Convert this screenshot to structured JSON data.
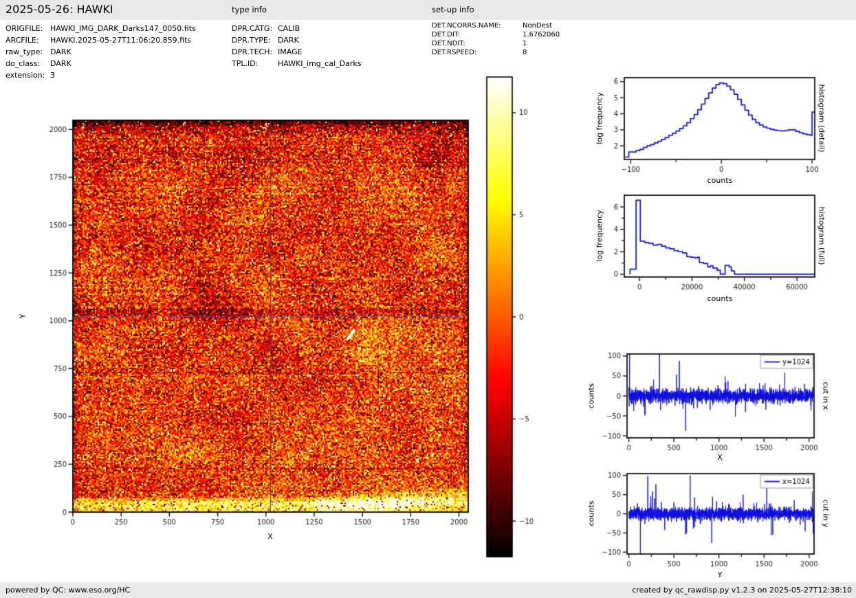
{
  "header": {
    "title": "2025-05-26: HAWKI",
    "type_info_label": "type info",
    "setup_info_label": "set-up info"
  },
  "file_info": {
    "rows": [
      {
        "label": "ORIGFILE:",
        "value": "HAWKI_IMG_DARK_Darks147_0050.fits"
      },
      {
        "label": "ARCFILE:",
        "value": "HAWKI.2025-05-27T11:06:20.859.fits"
      },
      {
        "label": "raw_type:",
        "value": "DARK"
      },
      {
        "label": "do_class:",
        "value": "DARK"
      },
      {
        "label": "extension:",
        "value": "3"
      }
    ]
  },
  "type_info": {
    "rows": [
      {
        "label": "DPR.CATG:",
        "value": "CALIB"
      },
      {
        "label": "DPR.TYPE:",
        "value": "DARK"
      },
      {
        "label": "DPR.TECH:",
        "value": "IMAGE"
      },
      {
        "label": "TPL.ID:",
        "value": "HAWKI_img_cal_Darks"
      }
    ]
  },
  "setup_info": {
    "rows": [
      {
        "label": "DET.NCORRS.NAME:",
        "value": "NonDest"
      },
      {
        "label": "DET.DIT:",
        "value": "1.6762060"
      },
      {
        "label": "DET.NDIT:",
        "value": "1"
      },
      {
        "label": "DET.RSPEED:",
        "value": "8"
      }
    ]
  },
  "footer": {
    "left": "powered by QC: www.eso.org/HC",
    "right": "created by qc_rawdisp.py v1.2.3 on 2025-05-27T12:38:10"
  },
  "colors": {
    "line_blue": "#0d0ddd",
    "crosshair_blue": "#2233cc",
    "bar_bg": "#e9e9e9",
    "spine": "#000000",
    "tick_text": "#1a1a1a"
  },
  "chart_data": [
    {
      "id": "main-image",
      "type": "heatmap",
      "xlabel": "X",
      "ylabel": "Y",
      "xlim": [
        0,
        2048
      ],
      "ylim": [
        0,
        2048
      ],
      "xticks": [
        0,
        250,
        500,
        750,
        1000,
        1250,
        1500,
        1750,
        2000
      ],
      "yticks": [
        0,
        250,
        500,
        750,
        1000,
        1250,
        1500,
        1750,
        2000
      ],
      "colormap": "hot",
      "value_range": [
        -11.75,
        11.75
      ],
      "crosshair": {
        "x": 1024,
        "y": 1024
      },
      "description": "2048x2048 noisy dark frame; dark band along top edge, bright white band along bottom edge, bright diagonal glow toward lower-right corner, dark stripe just above y=1024, white cosmic-ray streak near (1440,930), blue crosshair lines at x=1024 and y=1024",
      "render_params": {
        "seed": 99,
        "base_level": 0.46,
        "noise_sd": 0.16,
        "streak": {
          "x1": 1424,
          "y1": 905,
          "x2": 1456,
          "y2": 950
        }
      }
    },
    {
      "id": "colorbar",
      "type": "colorbar",
      "colormap": "hot",
      "vmin": -11.75,
      "vmax": 11.75,
      "ticks": [
        10,
        5,
        0,
        -5,
        -10
      ]
    },
    {
      "id": "hist-detail",
      "type": "line",
      "mode": "step",
      "xlabel": "counts",
      "ylabel": "log frequency",
      "side_label": "histogram (detail)",
      "xlim": [
        -107,
        103
      ],
      "ylim": [
        1.15,
        6.25
      ],
      "xticks": [
        -100,
        0,
        100
      ],
      "xminor": [
        -50,
        50
      ],
      "yticks": [
        2,
        3,
        4,
        5,
        6
      ],
      "yminor": [],
      "x": [
        -106,
        -102,
        -98,
        -94,
        -90,
        -86,
        -82,
        -78,
        -74,
        -70,
        -66,
        -62,
        -58,
        -54,
        -50,
        -46,
        -42,
        -38,
        -34,
        -30,
        -26,
        -22,
        -18,
        -14,
        -10,
        -6,
        -2,
        2,
        6,
        10,
        14,
        18,
        22,
        26,
        30,
        34,
        38,
        42,
        46,
        50,
        54,
        58,
        62,
        66,
        70,
        74,
        78,
        82,
        86,
        90,
        94,
        98,
        100,
        103
      ],
      "y": [
        1.3,
        1.62,
        1.62,
        1.7,
        1.78,
        1.9,
        2.0,
        2.08,
        2.18,
        2.28,
        2.4,
        2.52,
        2.65,
        2.78,
        2.92,
        3.08,
        3.25,
        3.45,
        3.7,
        3.95,
        4.25,
        4.6,
        4.95,
        5.3,
        5.6,
        5.82,
        5.92,
        5.88,
        5.72,
        5.5,
        5.22,
        4.9,
        4.55,
        4.22,
        3.92,
        3.65,
        3.45,
        3.3,
        3.18,
        3.1,
        3.03,
        2.98,
        2.95,
        2.93,
        2.95,
        3.0,
        3.0,
        2.9,
        2.82,
        2.75,
        2.7,
        2.65,
        4.1,
        4.1
      ]
    },
    {
      "id": "hist-full",
      "type": "line",
      "mode": "poly",
      "xlabel": "counts",
      "ylabel": "log frequency",
      "side_label": "histogram (full)",
      "xlim": [
        -5800,
        66800
      ],
      "ylim": [
        -0.25,
        7.05
      ],
      "xticks": [
        0,
        20000,
        40000,
        60000
      ],
      "xminor": [
        10000,
        30000,
        50000
      ],
      "yticks": [
        0,
        2,
        4,
        6
      ],
      "yminor": [
        1,
        3,
        5
      ],
      "points": [
        [
          -3600,
          0
        ],
        [
          -3600,
          0.45
        ],
        [
          -1300,
          0.45
        ],
        [
          -1300,
          6.6
        ],
        [
          300,
          6.6
        ],
        [
          300,
          2.95
        ],
        [
          2000,
          2.95
        ],
        [
          2000,
          2.82
        ],
        [
          3600,
          2.82
        ],
        [
          3600,
          2.76
        ],
        [
          5200,
          2.76
        ],
        [
          5200,
          2.6
        ],
        [
          6800,
          2.6
        ],
        [
          6800,
          2.66
        ],
        [
          8400,
          2.66
        ],
        [
          8400,
          2.5
        ],
        [
          10000,
          2.5
        ],
        [
          10000,
          2.35
        ],
        [
          11600,
          2.35
        ],
        [
          11600,
          2.27
        ],
        [
          13200,
          2.27
        ],
        [
          13200,
          2.1
        ],
        [
          14800,
          2.1
        ],
        [
          14800,
          2.02
        ],
        [
          16400,
          2.02
        ],
        [
          16400,
          1.9
        ],
        [
          18000,
          1.9
        ],
        [
          18000,
          1.57
        ],
        [
          19600,
          1.57
        ],
        [
          19600,
          1.5
        ],
        [
          21200,
          1.5
        ],
        [
          21200,
          1.45
        ],
        [
          22000,
          1.45
        ],
        [
          22000,
          1.52
        ],
        [
          22800,
          1.52
        ],
        [
          22800,
          1.05
        ],
        [
          24400,
          1.05
        ],
        [
          24400,
          0.95
        ],
        [
          26000,
          0.95
        ],
        [
          26000,
          0.65
        ],
        [
          27000,
          0.65
        ],
        [
          27000,
          0.75
        ],
        [
          28000,
          0.75
        ],
        [
          28000,
          0.55
        ],
        [
          29600,
          0.55
        ],
        [
          29600,
          0.35
        ],
        [
          30800,
          0.35
        ],
        [
          30800,
          0
        ],
        [
          32600,
          0
        ],
        [
          32600,
          0.78
        ],
        [
          34200,
          0.78
        ],
        [
          34200,
          0.65
        ],
        [
          35000,
          0.65
        ],
        [
          35000,
          0.3
        ],
        [
          36200,
          0.3
        ],
        [
          36200,
          0
        ],
        [
          68000,
          0
        ]
      ]
    },
    {
      "id": "cut-x",
      "type": "line",
      "mode": "noise",
      "legend": "y=1024",
      "xlabel": "X",
      "ylabel": "counts",
      "side_label": "cut in x",
      "xlim": [
        -20,
        2055
      ],
      "ylim": [
        -105,
        105
      ],
      "xticks": [
        0,
        500,
        1000,
        1500,
        2000
      ],
      "xminor": [
        250,
        750,
        1250,
        1750
      ],
      "yticks": [
        -100,
        -50,
        0,
        50,
        100
      ],
      "yminor": [],
      "n": 2048,
      "seed": 1234,
      "noise_sd": 8.5,
      "tail_sd": 22,
      "spikes": [
        [
          8,
          115
        ],
        [
          180,
          -45
        ],
        [
          340,
          115
        ],
        [
          352,
          -36
        ],
        [
          528,
          53
        ],
        [
          560,
          88
        ],
        [
          630,
          -88
        ],
        [
          760,
          -30
        ],
        [
          1068,
          49
        ],
        [
          1100,
          37
        ],
        [
          1182,
          -52
        ],
        [
          1295,
          30
        ],
        [
          1450,
          32
        ],
        [
          1520,
          -34
        ],
        [
          1730,
          58
        ],
        [
          1948,
          30
        ],
        [
          2040,
          22
        ]
      ]
    },
    {
      "id": "cut-y",
      "type": "line",
      "mode": "noise",
      "legend": "x=1024",
      "xlabel": "Y",
      "ylabel": "counts",
      "side_label": "cut in y",
      "xlim": [
        -20,
        2055
      ],
      "ylim": [
        -105,
        105
      ],
      "xticks": [
        0,
        500,
        1000,
        1500,
        2000
      ],
      "xminor": [
        250,
        750,
        1250,
        1750
      ],
      "yticks": [
        -100,
        -50,
        0,
        50,
        100
      ],
      "yminor": [],
      "n": 2048,
      "seed": 5678,
      "noise_sd": 8.5,
      "tail_sd": 22,
      "spikes": [
        [
          128,
          -112
        ],
        [
          210,
          98
        ],
        [
          244,
          46
        ],
        [
          263,
          58
        ],
        [
          284,
          40
        ],
        [
          300,
          77
        ],
        [
          398,
          -42
        ],
        [
          500,
          30
        ],
        [
          680,
          100
        ],
        [
          728,
          -35
        ],
        [
          920,
          -76
        ],
        [
          1235,
          30
        ],
        [
          1530,
          90
        ],
        [
          1597,
          -55
        ],
        [
          1835,
          36
        ],
        [
          2036,
          58
        ],
        [
          2046,
          -52
        ]
      ]
    }
  ]
}
